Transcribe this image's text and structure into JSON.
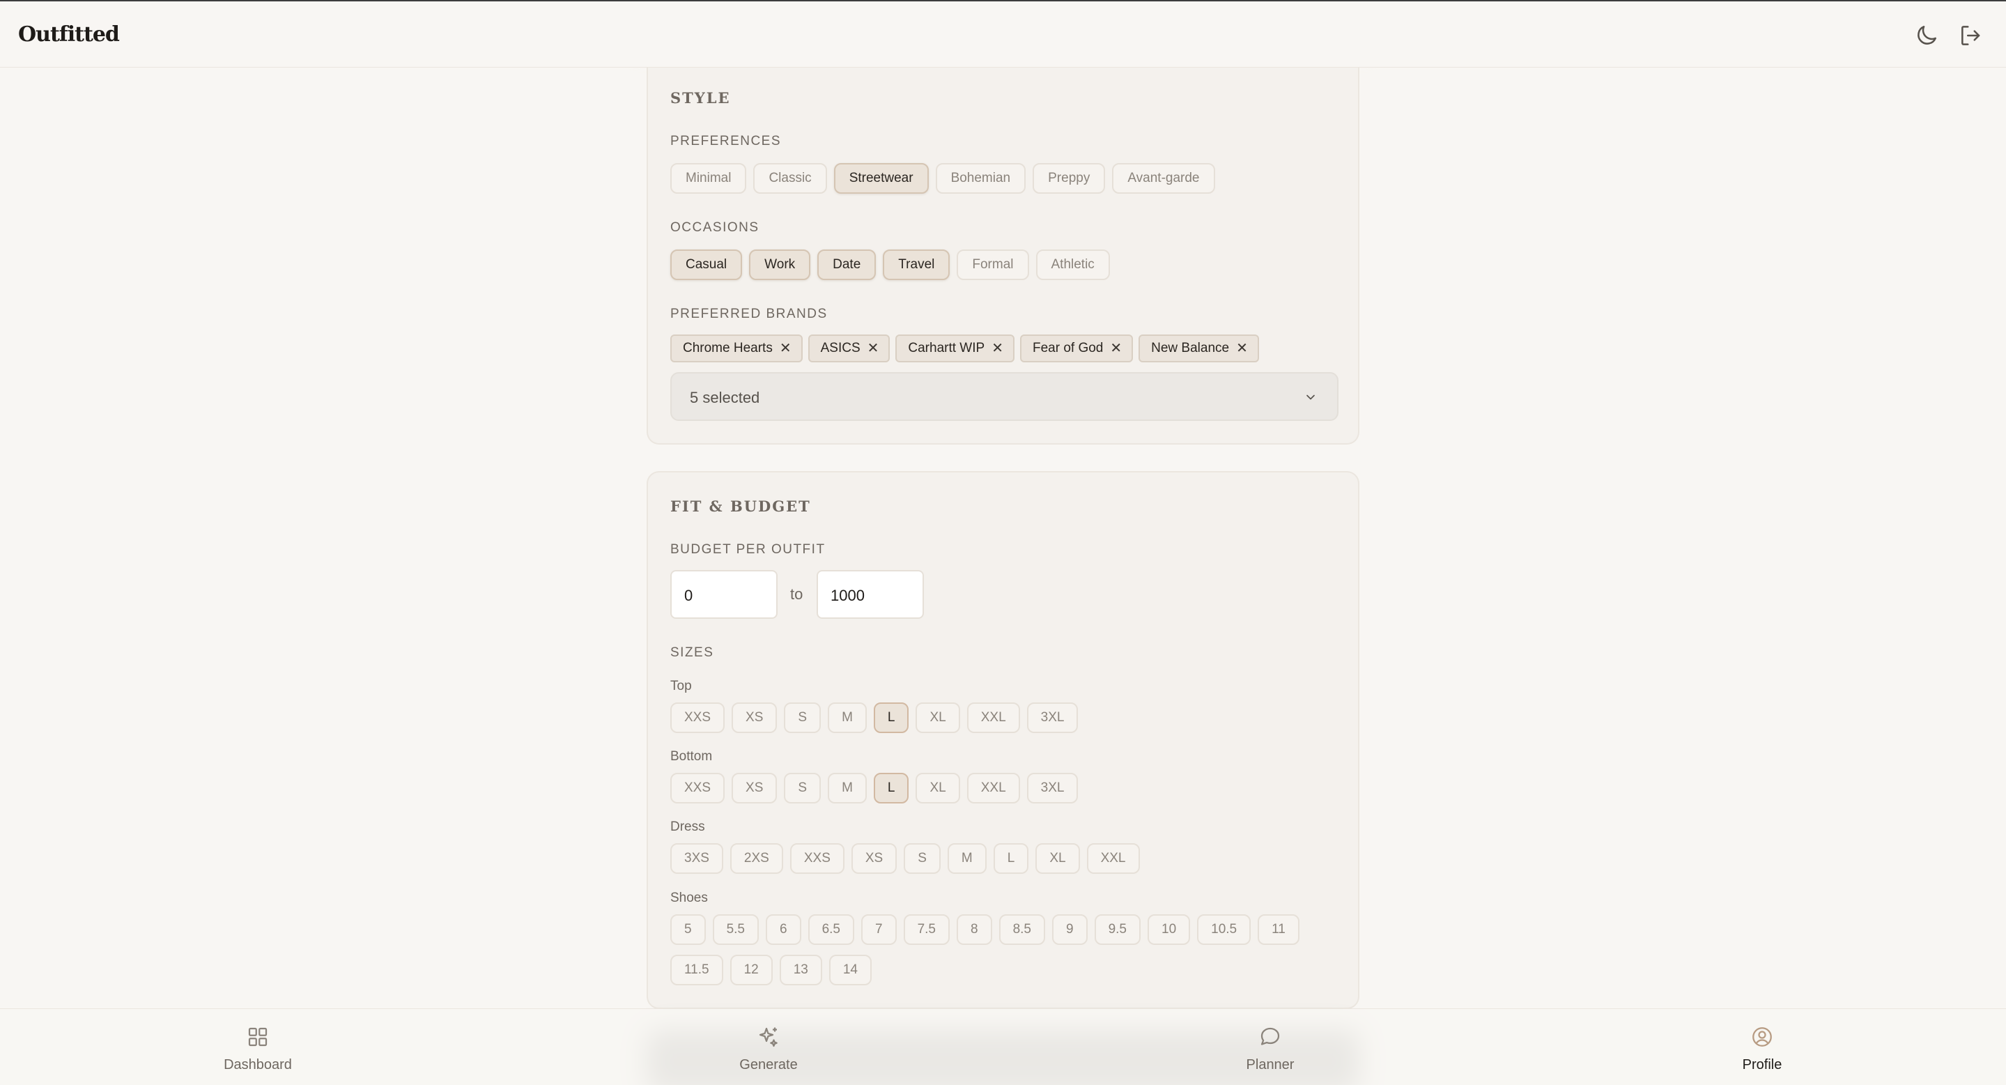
{
  "app": {
    "title": "Outfitted"
  },
  "header": {
    "icons": [
      "moon-icon",
      "logout-icon"
    ]
  },
  "style_section": {
    "title": "STYLE",
    "preferences": {
      "label": "PREFERENCES",
      "options": [
        {
          "label": "Minimal",
          "selected": false
        },
        {
          "label": "Classic",
          "selected": false
        },
        {
          "label": "Streetwear",
          "selected": true
        },
        {
          "label": "Bohemian",
          "selected": false
        },
        {
          "label": "Preppy",
          "selected": false
        },
        {
          "label": "Avant-garde",
          "selected": false
        }
      ]
    },
    "occasions": {
      "label": "OCCASIONS",
      "options": [
        {
          "label": "Casual",
          "selected": true
        },
        {
          "label": "Work",
          "selected": true
        },
        {
          "label": "Date",
          "selected": true
        },
        {
          "label": "Travel",
          "selected": true
        },
        {
          "label": "Formal",
          "selected": false
        },
        {
          "label": "Athletic",
          "selected": false
        }
      ]
    },
    "brands": {
      "label": "PREFERRED BRANDS",
      "tags": [
        "Chrome Hearts",
        "ASICS",
        "Carhartt WIP",
        "Fear of God",
        "New Balance"
      ],
      "remove_glyph": "✕",
      "dropdown_value": "5 selected"
    }
  },
  "fit_section": {
    "title": "FIT & BUDGET",
    "budget": {
      "label": "BUDGET PER OUTFIT",
      "min": "0",
      "separator": "to",
      "max": "1000"
    },
    "sizes": {
      "label": "SIZES",
      "top": {
        "label": "Top",
        "options": [
          "XXS",
          "XS",
          "S",
          "M",
          "L",
          "XL",
          "XXL",
          "3XL"
        ],
        "selected": "L"
      },
      "bottom": {
        "label": "Bottom",
        "options": [
          "XXS",
          "XS",
          "S",
          "M",
          "L",
          "XL",
          "XXL",
          "3XL"
        ],
        "selected": "L"
      },
      "dress": {
        "label": "Dress",
        "options": [
          "3XS",
          "2XS",
          "XXS",
          "XS",
          "S",
          "M",
          "L",
          "XL",
          "XXL"
        ],
        "selected": null
      },
      "shoes": {
        "label": "Shoes",
        "options_row1": [
          "5",
          "5.5",
          "6",
          "6.5",
          "7",
          "7.5",
          "8",
          "8.5",
          "9",
          "9.5",
          "10",
          "10.5",
          "11"
        ],
        "options_row2": [
          "11.5",
          "12",
          "13",
          "14"
        ],
        "selected": null
      }
    }
  },
  "bottom_nav": {
    "items": [
      {
        "label": "Dashboard",
        "icon": "grid-icon",
        "active": false
      },
      {
        "label": "Generate",
        "icon": "sparkle-icon",
        "active": false
      },
      {
        "label": "Planner",
        "icon": "chat-bubble-icon",
        "active": false
      },
      {
        "label": "Profile",
        "icon": "user-circle-icon",
        "active": true
      }
    ]
  }
}
